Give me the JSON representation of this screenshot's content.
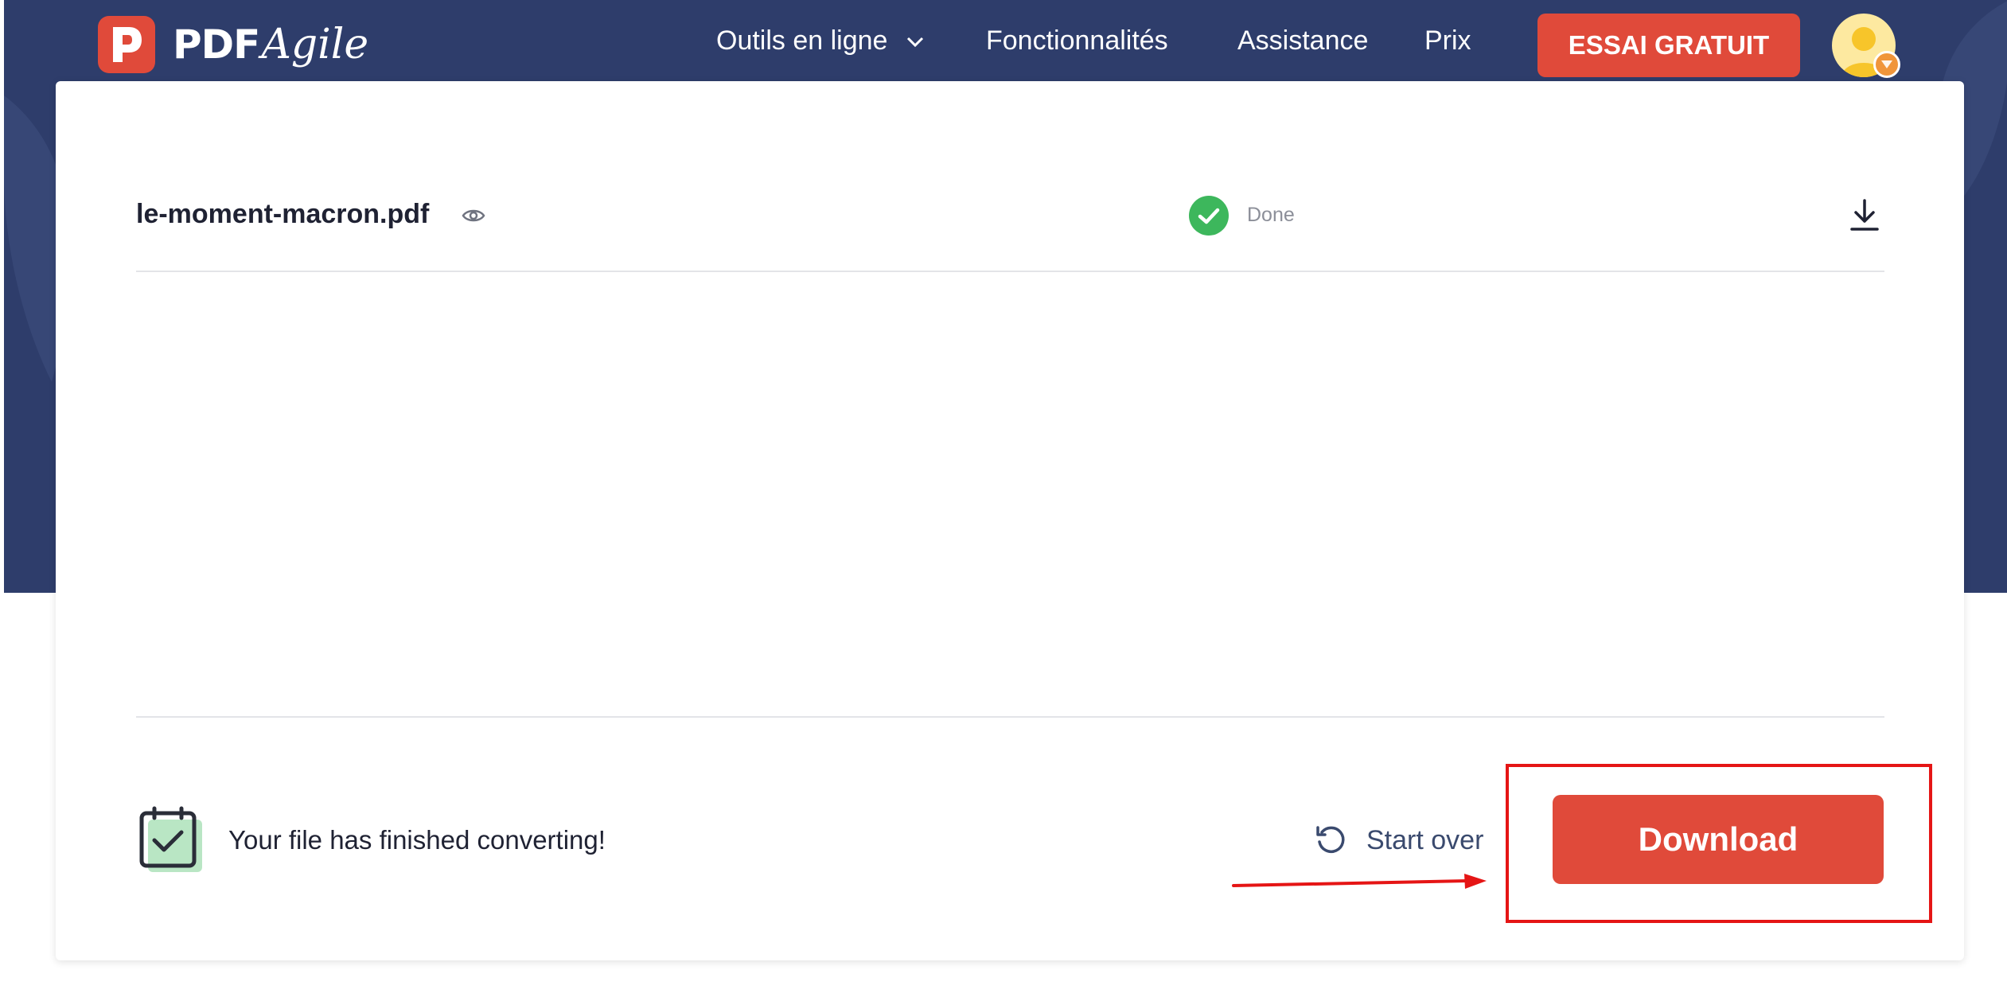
{
  "header": {
    "logo_text": "PDF",
    "logo_script": "Agile",
    "nav": [
      {
        "label": "Outils en ligne",
        "has_dropdown": true
      },
      {
        "label": "Fonctionnalités"
      },
      {
        "label": "Assistance"
      },
      {
        "label": "Prix"
      }
    ],
    "trial_button": "ESSAI GRATUIT",
    "avatar_icon": "user-avatar-icon"
  },
  "file": {
    "name": "le-moment-macron.pdf",
    "status": "Done",
    "status_color": "#3db75c"
  },
  "footer": {
    "message": "Your file has finished converting!",
    "start_over": "Start over",
    "download": "Download"
  },
  "colors": {
    "accent": "#e04a3a",
    "hero_bg": "#2e3d6b",
    "annotation": "#e51515"
  }
}
